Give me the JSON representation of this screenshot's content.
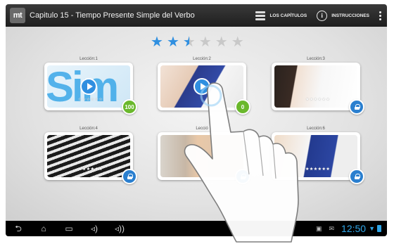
{
  "app": {
    "logo_text": "mt",
    "title": "Capitulo 15 - Tiempo Presente Simple del Verbo"
  },
  "actionbar": {
    "chapters_label": "LOS CAPÍTULOS",
    "instructions_label": "INSTRUCCIONES",
    "info_glyph": "i"
  },
  "rating": {
    "value": 2.5,
    "max": 6,
    "active_color": "#2f8fe0",
    "inactive_color": "#c8c8c8"
  },
  "lessons": [
    {
      "label": "Lección:1",
      "badge": "100",
      "badge_type": "score",
      "stars": "☆☆☆☆☆☆",
      "thumb_text": "Sim",
      "has_play": true
    },
    {
      "label": "Lección:2",
      "badge": "0",
      "badge_type": "score",
      "stars": "",
      "has_play": true
    },
    {
      "label": "Lección:3",
      "badge": "",
      "badge_type": "locked",
      "stars": "★★★★★★"
    },
    {
      "label": "Lección:4",
      "badge": "",
      "badge_type": "locked",
      "stars": "★★★★★★"
    },
    {
      "label": "Lecció",
      "badge": "",
      "badge_type": "locked",
      "stars": ""
    },
    {
      "label": "Lección:6",
      "badge": "",
      "badge_type": "locked",
      "stars": "★★★★★★"
    }
  ],
  "navbar": {
    "back_icon": "back-arrow-icon",
    "home_icon": "home-icon",
    "recents_icon": "recent-apps-icon",
    "vol_down_icon": "volume-down-icon",
    "vol_up_icon": "volume-up-icon",
    "clock": "12:50"
  },
  "colors": {
    "accent": "#2f8fe0",
    "score_green": "#6ab82c",
    "lock_blue": "#2a7fcf",
    "clock_blue": "#2fa6e8"
  }
}
